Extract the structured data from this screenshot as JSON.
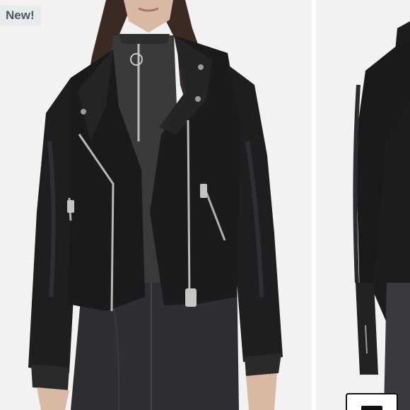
{
  "badge": {
    "label": "New!"
  },
  "gallery": {
    "slides": [
      {
        "icon": "black-leather-biker-jacket-front-photo"
      },
      {
        "icon": "black-leather-biker-jacket-side-photo"
      }
    ],
    "thumbnail_button": {
      "icon": "image-thumbnail-icon"
    }
  },
  "colors": {
    "badge_bg": "#e6ebee",
    "badge_text": "#4a5964",
    "photo_bg": "#f2f2f2",
    "leather": "#1c1c1e",
    "zipper": "#b9b9b9"
  }
}
